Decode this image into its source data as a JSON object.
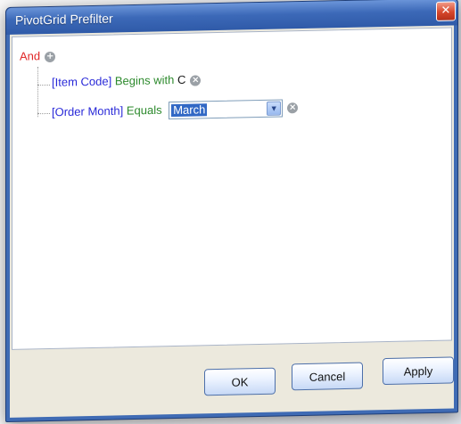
{
  "window": {
    "title": "PivotGrid Prefilter",
    "close_glyph": "✕"
  },
  "filter": {
    "root_operator": "And",
    "conditions": [
      {
        "field": "[Item Code]",
        "operation": "Begins with",
        "value": "C"
      },
      {
        "field": "[Order Month]",
        "operation": "Equals",
        "value": "March"
      }
    ]
  },
  "icons": {
    "add": "+",
    "remove": "×",
    "dropdown": "▼"
  },
  "buttons": {
    "ok": "OK",
    "cancel": "Cancel",
    "apply": "Apply"
  },
  "colors": {
    "operator": "#e02626",
    "field": "#2828d8",
    "operation": "#2d8a2d",
    "title_bar": "#3c69b8",
    "close_button": "#d6472c"
  }
}
